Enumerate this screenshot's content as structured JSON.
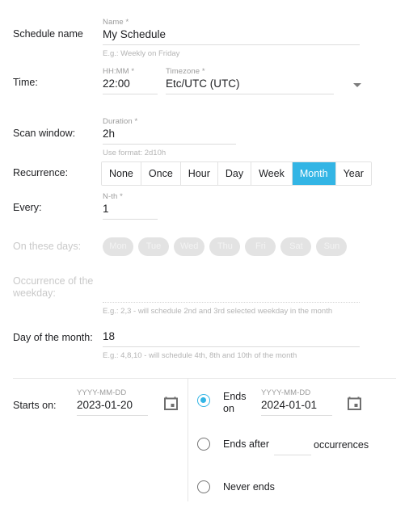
{
  "theme": {
    "accent": "#33b5e5",
    "label_color": "#202124",
    "muted_color": "#9b9b9b",
    "hint_color": "#b4b4b4",
    "disabled_color": "#c9c9c9",
    "underline_color": "#dcdcdc"
  },
  "rows": {
    "schedule_name": {
      "label": "Schedule name",
      "field_label": "Name *",
      "value": "My Schedule",
      "hint": "E.g.: Weekly on Friday"
    },
    "time": {
      "label": "Time:",
      "hhmm": {
        "field_label": "HH:MM *",
        "value": "22:00"
      },
      "timezone": {
        "field_label": "Timezone *",
        "value": "Etc/UTC (UTC)",
        "icon": "chevron-down-icon"
      }
    },
    "scan_window": {
      "label": "Scan window:",
      "field_label": "Duration *",
      "value": "2h",
      "hint": "Use format: 2d10h"
    },
    "recurrence": {
      "label": "Recurrence:",
      "options": [
        "None",
        "Once",
        "Hour",
        "Day",
        "Week",
        "Month",
        "Year"
      ],
      "selected": "Month"
    },
    "every": {
      "label": "Every:",
      "field_label": "N-th *",
      "value": "1"
    },
    "on_these_days": {
      "label": "On these days:",
      "disabled": true,
      "days": [
        "Mon",
        "Tue",
        "Wed",
        "Thu",
        "Fri",
        "Sat",
        "Sun"
      ],
      "selected": []
    },
    "occurrence_weekday": {
      "label": "Occurrence of the\nweekday:",
      "disabled": true,
      "value": "",
      "hint": "E.g.: 2,3 - will schedule 2nd and 3rd selected weekday in the month"
    },
    "day_of_month": {
      "label": "Day of the month:",
      "value": "18",
      "hint": "E.g.: 4,8,10 - will schedule 4th, 8th and 10th of the month"
    },
    "starts_on": {
      "label": "Starts on:",
      "field_label": "YYYY-MM-DD",
      "value": "2023-01-20",
      "icon": "calendar-icon"
    }
  },
  "ends": {
    "selected": "ends_on",
    "options": [
      {
        "id": "ends_on",
        "label": "Ends\non",
        "field_label": "YYYY-MM-DD",
        "value": "2024-01-01",
        "icon": "calendar-icon",
        "checked": true
      },
      {
        "id": "ends_after",
        "label": "Ends after",
        "value": "",
        "suffix": "occurrences",
        "checked": false
      },
      {
        "id": "never_ends",
        "label": "Never ends",
        "checked": false
      }
    ]
  }
}
